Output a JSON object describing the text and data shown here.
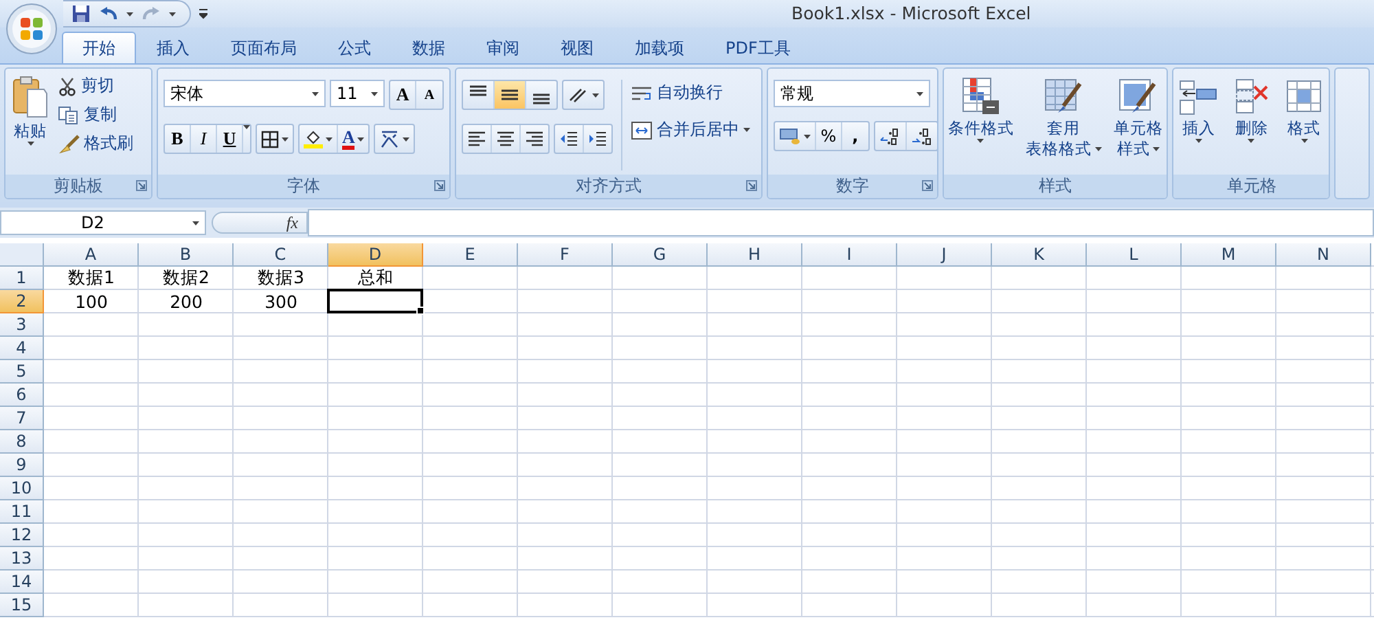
{
  "title": "Book1.xlsx - Microsoft Excel",
  "tabs": [
    {
      "label": "开始",
      "selected": true
    },
    {
      "label": "插入",
      "selected": false
    },
    {
      "label": "页面布局",
      "selected": false
    },
    {
      "label": "公式",
      "selected": false
    },
    {
      "label": "数据",
      "selected": false
    },
    {
      "label": "审阅",
      "selected": false
    },
    {
      "label": "视图",
      "selected": false
    },
    {
      "label": "加载项",
      "selected": false
    },
    {
      "label": "PDF工具",
      "selected": false
    }
  ],
  "clipboard": {
    "label": "剪贴板",
    "paste": "粘贴",
    "actions": [
      {
        "kind": "cut",
        "label": "剪切"
      },
      {
        "kind": "copy",
        "label": "复制"
      },
      {
        "kind": "brush",
        "label": "格式刷"
      }
    ]
  },
  "font": {
    "label": "字体",
    "font_name": "宋体",
    "font_size": "11",
    "grow": "A",
    "shrink": "A",
    "bold": "B",
    "italic": "I",
    "underline": "U",
    "font_color": "A"
  },
  "alignment": {
    "label": "对齐方式",
    "vertical": [
      {
        "kind": "top",
        "selected": false
      },
      {
        "kind": "middle",
        "selected": true
      },
      {
        "kind": "bottom",
        "selected": false
      }
    ],
    "wrap": "自动换行",
    "merge": "合并后居中"
  },
  "number": {
    "label": "数字",
    "format": "常规",
    "percent": "%",
    "comma": ","
  },
  "styles": {
    "label": "样式",
    "buttons": [
      {
        "kind": "conditional",
        "lines": [
          "条件格式"
        ]
      },
      {
        "kind": "table",
        "lines": [
          "套用",
          "表格格式"
        ]
      },
      {
        "kind": "cellstyle",
        "lines": [
          "单元格",
          "样式"
        ]
      }
    ]
  },
  "cells": {
    "label": "单元格",
    "buttons": [
      {
        "kind": "insert",
        "label": "插入"
      },
      {
        "kind": "delete",
        "label": "删除"
      },
      {
        "kind": "format",
        "label": "格式"
      }
    ]
  },
  "formula_bar": {
    "name_box": "D2",
    "fx": "fx"
  },
  "sheet": {
    "columns": [
      {
        "label": "A",
        "selected": false
      },
      {
        "label": "B",
        "selected": false
      },
      {
        "label": "C",
        "selected": false
      },
      {
        "label": "D",
        "selected": true
      },
      {
        "label": "E",
        "selected": false
      },
      {
        "label": "F",
        "selected": false
      },
      {
        "label": "G",
        "selected": false
      },
      {
        "label": "H",
        "selected": false
      },
      {
        "label": "I",
        "selected": false
      },
      {
        "label": "J",
        "selected": false
      },
      {
        "label": "K",
        "selected": false
      },
      {
        "label": "L",
        "selected": false
      },
      {
        "label": "M",
        "selected": false
      },
      {
        "label": "N",
        "selected": false
      }
    ],
    "rows": [
      {
        "label": "1",
        "selected": false,
        "cells": [
          {
            "text": "数据1",
            "selected": false
          },
          {
            "text": "数据2",
            "selected": false
          },
          {
            "text": "数据3",
            "selected": false
          },
          {
            "text": "总和",
            "selected": false
          }
        ]
      },
      {
        "label": "2",
        "selected": true,
        "cells": [
          {
            "text": "100",
            "selected": false
          },
          {
            "text": "200",
            "selected": false
          },
          {
            "text": "300",
            "selected": false
          },
          {
            "selected": true
          }
        ]
      },
      {
        "label": "3",
        "selected": false
      },
      {
        "label": "4",
        "selected": false
      },
      {
        "label": "5",
        "selected": false
      },
      {
        "label": "6",
        "selected": false
      },
      {
        "label": "7",
        "selected": false
      },
      {
        "label": "8",
        "selected": false
      },
      {
        "label": "9",
        "selected": false
      },
      {
        "label": "10",
        "selected": false
      },
      {
        "label": "11",
        "selected": false
      },
      {
        "label": "12",
        "selected": false
      },
      {
        "label": "13",
        "selected": false
      },
      {
        "label": "14",
        "selected": false
      },
      {
        "label": "15",
        "selected": false
      }
    ]
  }
}
